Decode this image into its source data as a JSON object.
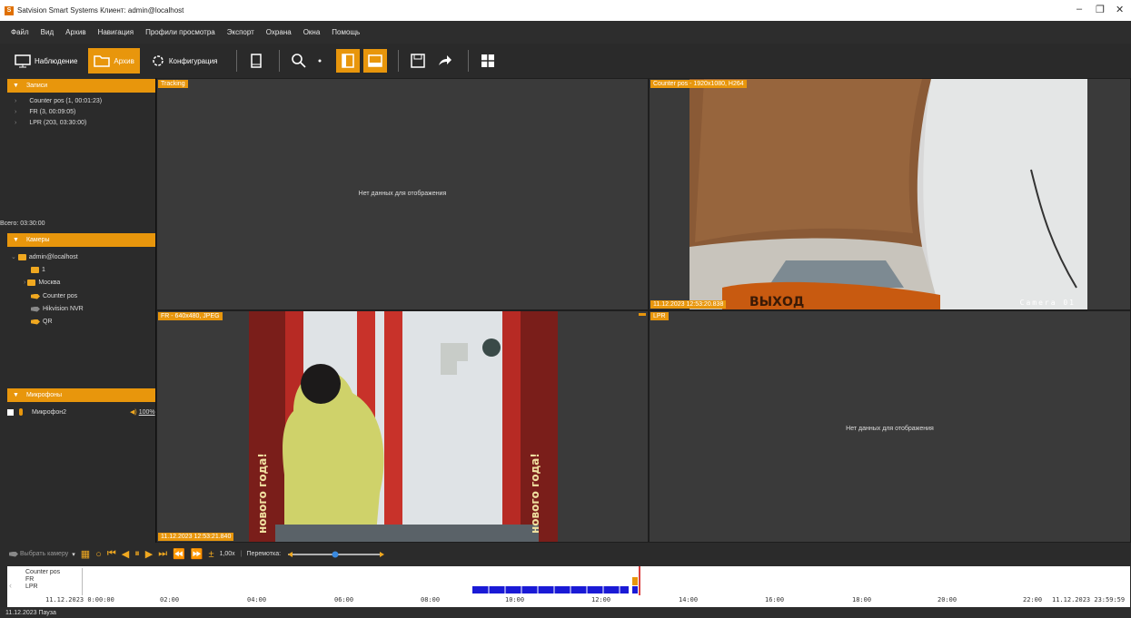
{
  "window": {
    "title": "Satvision Smart Systems Клиент: admin@localhost",
    "minimize": "–",
    "restore": "❐",
    "close": "✕"
  },
  "menu": [
    "Файл",
    "Вид",
    "Архив",
    "Навигация",
    "Профили просмотра",
    "Экспорт",
    "Охрана",
    "Окна",
    "Помощь"
  ],
  "toolbar": {
    "observe_label": "Наблюдение",
    "archive_label": "Архив",
    "config_label": "Конфигурация"
  },
  "records": {
    "header": "Записи",
    "items": [
      "Counter pos (1, 00:01:23)",
      "FR (3, 00:09:05)",
      "LPR (203, 03:30:00)"
    ],
    "total": "Всего: 03:30:00"
  },
  "cameras": {
    "header": "Камеры",
    "root": "admin@localhost",
    "items": [
      "1",
      "Москва",
      "Counter pos",
      "Hikvision NVR",
      "QR"
    ]
  },
  "mics": {
    "header": "Микрофоны",
    "item": "Микрофон2",
    "volume": "100%"
  },
  "views": {
    "tracking": {
      "label": "Tracking",
      "nodata": "Нет данных для отображения"
    },
    "counter": {
      "label": "Counter pos - 1920x1080, H264",
      "ts": "11.12.2023 12:53:20.838",
      "overlay": "Camera 01"
    },
    "fr": {
      "label": "FR - 640x480, JPEG",
      "ts": "11.12.2023 12:53:21.840"
    },
    "lpr": {
      "label": "LPR",
      "nodata": "Нет данных для отображения"
    }
  },
  "controls": {
    "camera_select": "Выбрать камеру",
    "speed": "1,00x",
    "rewind_label": "Перемотка:"
  },
  "timeline": {
    "tracks": [
      "Counter pos",
      "FR",
      "LPR"
    ],
    "start": "11.12.2023 0:00:00",
    "ticks": [
      "02:00",
      "04:00",
      "06:00",
      "08:00",
      "10:00",
      "12:00",
      "14:00",
      "16:00",
      "18:00",
      "20:00",
      "22:00"
    ],
    "end": "11.12.2023 23:59:59"
  },
  "status": "11.12.2023 Пауза",
  "colors": {
    "accent": "#e8960c",
    "timeline_blue": "#1a1ad6",
    "cursor_red": "#d00000"
  }
}
